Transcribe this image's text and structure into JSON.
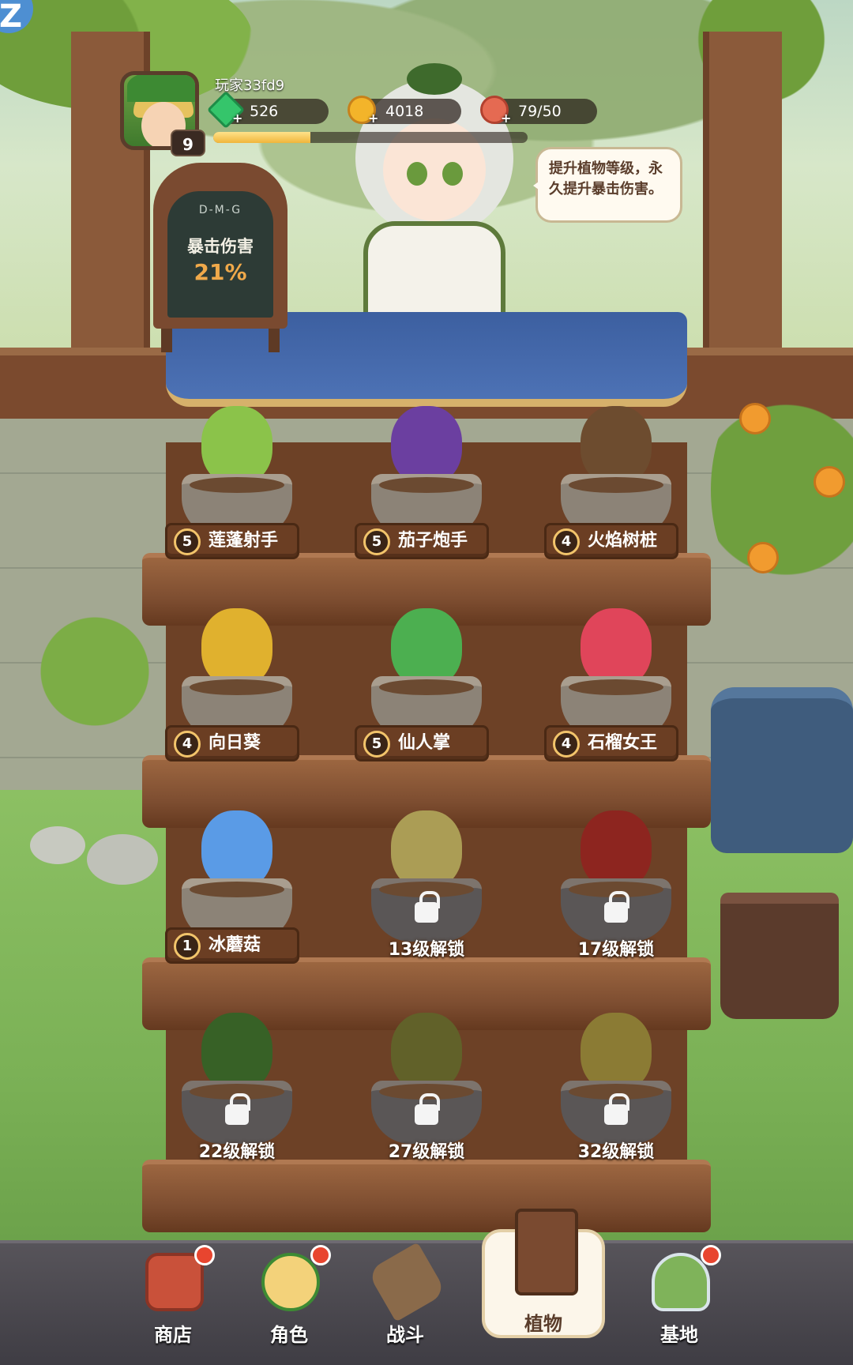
{
  "player": {
    "name": "玩家33fd9",
    "level": "9",
    "xp_fraction": 0.31,
    "gems": "526",
    "coins": "4018",
    "stamina": "79/50"
  },
  "npc": {
    "speech": "提升植物等级，永久提升暴击伤害。"
  },
  "chalkboard": {
    "scribble": "D-M-G",
    "label": "暴击伤害",
    "value": "21%"
  },
  "plants": [
    {
      "name": "莲蓬射手",
      "level": "5",
      "locked": false,
      "color": "#8bc34a"
    },
    {
      "name": "茄子炮手",
      "level": "5",
      "locked": false,
      "color": "#6b3fa0"
    },
    {
      "name": "火焰树桩",
      "level": "4",
      "locked": false,
      "color": "#6d4c2f"
    },
    {
      "name": "向日葵",
      "level": "4",
      "locked": false,
      "color": "#e0b12e"
    },
    {
      "name": "仙人掌",
      "level": "5",
      "locked": false,
      "color": "#4caf50"
    },
    {
      "name": "石榴女王",
      "level": "4",
      "locked": false,
      "color": "#e0455a"
    },
    {
      "name": "冰蘑菇",
      "level": "1",
      "locked": false,
      "color": "#5a9be6"
    },
    {
      "unlock": "13级解锁",
      "locked": true,
      "color": "#f4e07a"
    },
    {
      "unlock": "17级解锁",
      "locked": true,
      "color": "#c9352c"
    },
    {
      "unlock": "22级解锁",
      "locked": true,
      "color": "#4f8a36"
    },
    {
      "unlock": "27级解锁",
      "locked": true,
      "color": "#8a8a3a"
    },
    {
      "unlock": "32级解锁",
      "locked": true,
      "color": "#c7b04a"
    }
  ],
  "nav": {
    "shop": "商店",
    "character": "角色",
    "battle": "战斗",
    "plants": "植物",
    "base": "基地"
  }
}
